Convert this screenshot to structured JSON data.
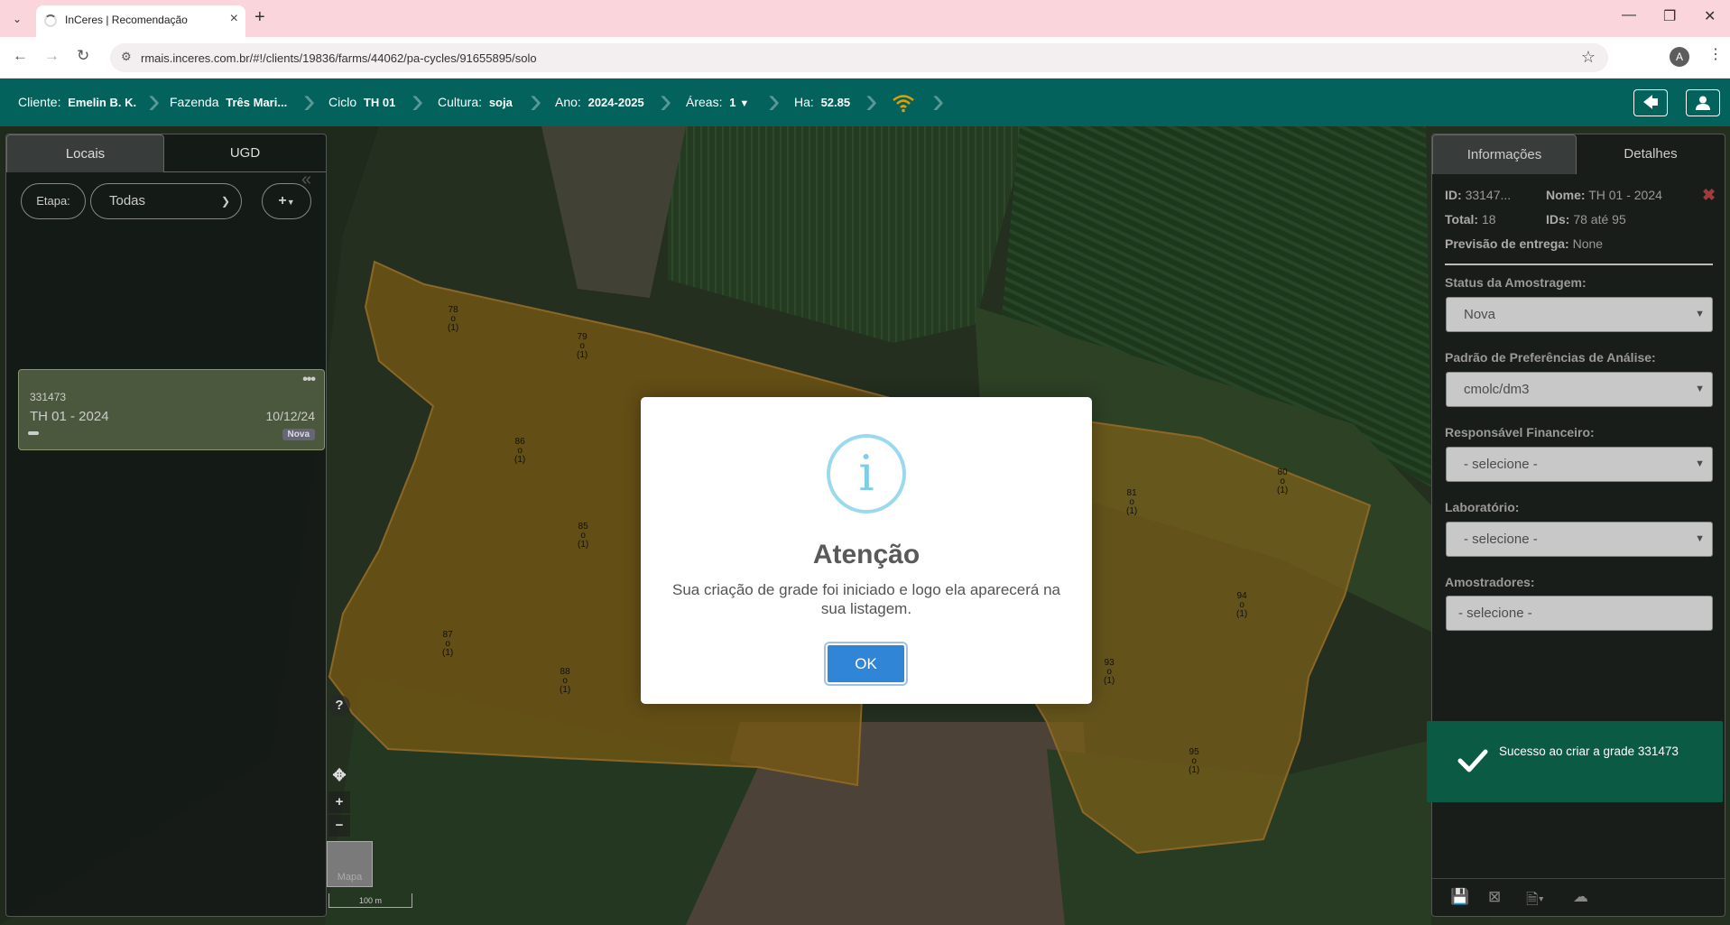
{
  "browser": {
    "tab_title": "InCeres | Recomendação",
    "url": "rmais.inceres.com.br/#!/clients/19836/farms/44062/pa-cycles/91655895/solo",
    "profile_initial": "A"
  },
  "header": {
    "cliente_label": "Cliente:",
    "cliente_value": "Emelin B. K.",
    "fazenda_label": "Fazenda",
    "fazenda_value": "Três Mari...",
    "ciclo_label": "Ciclo",
    "ciclo_value": "TH 01",
    "cultura_label": "Cultura:",
    "cultura_value": "soja",
    "ano_label": "Ano:",
    "ano_value": "2024-2025",
    "areas_label": "Áreas:",
    "areas_value": "1",
    "ha_label": "Ha:",
    "ha_value": "52.85",
    "colors": {
      "bar": "#03625c",
      "wifi": "#e0a100"
    }
  },
  "left_panel": {
    "tabs": [
      "Locais",
      "UGD"
    ],
    "etapa_label": "Etapa:",
    "etapa_value": "Todas",
    "add_label": "+",
    "card": {
      "id": "331473",
      "name": "TH 01 - 2024",
      "date": "10/12/24",
      "badge": "Nova"
    }
  },
  "right_panel": {
    "tabs": [
      "Informações",
      "Detalhes"
    ],
    "id_label": "ID:",
    "id_value": "33147...",
    "nome_label": "Nome:",
    "nome_value": "TH 01 - 2024",
    "total_label": "Total:",
    "total_value": "18",
    "ids_label": "IDs:",
    "ids_value": "78 até 95",
    "previsao_label": "Previsão de entrega:",
    "previsao_value": "None",
    "fields": [
      {
        "label": "Status da Amostragem:",
        "value": "Nova"
      },
      {
        "label": "Padrão de Preferências de Análise:",
        "value": "cmolc/dm3"
      },
      {
        "label": "Responsável Financeiro:",
        "value": "- selecione -"
      },
      {
        "label": "Laboratório:",
        "value": "- selecione -"
      },
      {
        "label": "Amostradores:",
        "value": "- selecione -"
      }
    ]
  },
  "toast": {
    "message": "Sucesso ao criar a grade 331473",
    "color": "#0b5b44"
  },
  "map": {
    "help": "?",
    "zoom_in": "+",
    "zoom_out": "−",
    "minimap_label": "Mapa",
    "scale_label": "100 m",
    "points": [
      {
        "id": "78",
        "count": "(1)"
      },
      {
        "id": "79",
        "count": "(1)"
      },
      {
        "id": "86",
        "count": "(1)"
      },
      {
        "id": "85",
        "count": "(1)"
      },
      {
        "id": "87",
        "count": "(1)"
      },
      {
        "id": "88",
        "count": "(1)"
      },
      {
        "id": "81",
        "count": "(1)"
      },
      {
        "id": "80",
        "count": "(1)"
      },
      {
        "id": "94",
        "count": "(1)"
      },
      {
        "id": "93",
        "count": "(1)"
      },
      {
        "id": "95",
        "count": "(1)"
      }
    ]
  },
  "modal": {
    "icon": "i",
    "title": "Atenção",
    "text": "Sua criação de grade foi iniciado e logo ela aparecerá na sua listagem.",
    "ok_label": "OK",
    "colors": {
      "button": "#3085d6",
      "icon": "#9ad9ee"
    }
  }
}
